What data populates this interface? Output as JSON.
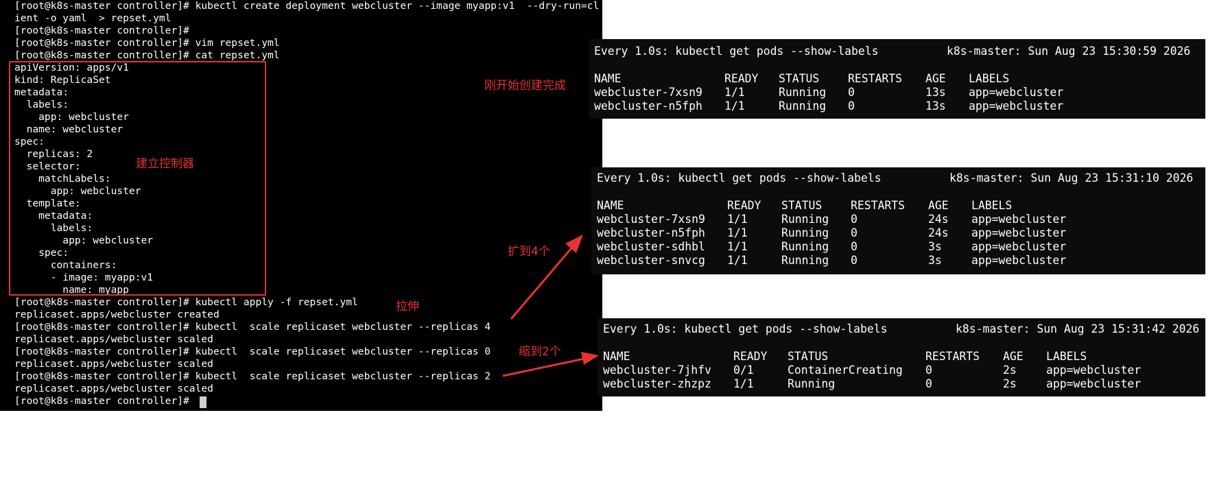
{
  "terminal": {
    "lines": [
      "[root@k8s-master controller]# kubectl create deployment webcluster --image myapp:v1  --dry-run=cl",
      "ient -o yaml  > repset.yml",
      "[root@k8s-master controller]#",
      "[root@k8s-master controller]# vim repset.yml",
      "[root@k8s-master controller]# cat repset.yml",
      "apiVersion: apps/v1",
      "kind: ReplicaSet",
      "metadata:",
      "  labels:",
      "    app: webcluster",
      "  name: webcluster",
      "spec:",
      "  replicas: 2",
      "  selector:",
      "    matchLabels:",
      "      app: webcluster",
      "  template:",
      "    metadata:",
      "      labels:",
      "        app: webcluster",
      "    spec:",
      "      containers:",
      "      - image: myapp:v1",
      "        name: myapp",
      "[root@k8s-master controller]# kubectl apply -f repset.yml",
      "replicaset.apps/webcluster created",
      "[root@k8s-master controller]# kubectl  scale replicaset webcluster --replicas 4",
      "replicaset.apps/webcluster scaled",
      "[root@k8s-master controller]# kubectl  scale replicaset webcluster --replicas 0",
      "replicaset.apps/webcluster scaled",
      "[root@k8s-master controller]# kubectl  scale replicaset webcluster --replicas 2",
      "replicaset.apps/webcluster scaled",
      "[root@k8s-master controller]# "
    ]
  },
  "annotations": {
    "create_controller": "建立控制器",
    "just_created": "刚开始创建完成",
    "scale_up": "扩到4个",
    "stretch": "拉伸",
    "scale_down": "缩到2个"
  },
  "watch_panels": [
    {
      "header_cmd": "Every 1.0s: kubectl get pods --show-labels",
      "header_host": "k8s-master: Sun Aug 23 15:30:59 2026",
      "columns": [
        "NAME",
        "READY",
        "STATUS",
        "RESTARTS",
        "AGE",
        "LABELS"
      ],
      "rows": [
        [
          "webcluster-7xsn9",
          "1/1",
          "Running",
          "0",
          "13s",
          "app=webcluster"
        ],
        [
          "webcluster-n5fph",
          "1/1",
          "Running",
          "0",
          "13s",
          "app=webcluster"
        ]
      ]
    },
    {
      "header_cmd": "Every 1.0s: kubectl get pods --show-labels",
      "header_host": "k8s-master: Sun Aug 23 15:31:10 2026",
      "columns": [
        "NAME",
        "READY",
        "STATUS",
        "RESTARTS",
        "AGE",
        "LABELS"
      ],
      "rows": [
        [
          "webcluster-7xsn9",
          "1/1",
          "Running",
          "0",
          "24s",
          "app=webcluster"
        ],
        [
          "webcluster-n5fph",
          "1/1",
          "Running",
          "0",
          "24s",
          "app=webcluster"
        ],
        [
          "webcluster-sdhbl",
          "1/1",
          "Running",
          "0",
          "3s",
          "app=webcluster"
        ],
        [
          "webcluster-snvcg",
          "1/1",
          "Running",
          "0",
          "3s",
          "app=webcluster"
        ]
      ]
    },
    {
      "header_cmd": "Every 1.0s: kubectl get pods --show-labels",
      "header_host": "k8s-master: Sun Aug 23 15:31:42 2026",
      "columns": [
        "NAME",
        "READY",
        "STATUS",
        "RESTARTS",
        "AGE",
        "LABELS"
      ],
      "rows": [
        [
          "webcluster-7jhfv",
          "0/1",
          "ContainerCreating",
          "0",
          "2s",
          "app=webcluster"
        ],
        [
          "webcluster-zhzpz",
          "1/1",
          "Running",
          "0",
          "2s",
          "app=webcluster"
        ]
      ]
    }
  ],
  "colors": {
    "annotation": "#e53333",
    "terminal_bg": "#000000",
    "terminal_fg": "#ffffff"
  }
}
